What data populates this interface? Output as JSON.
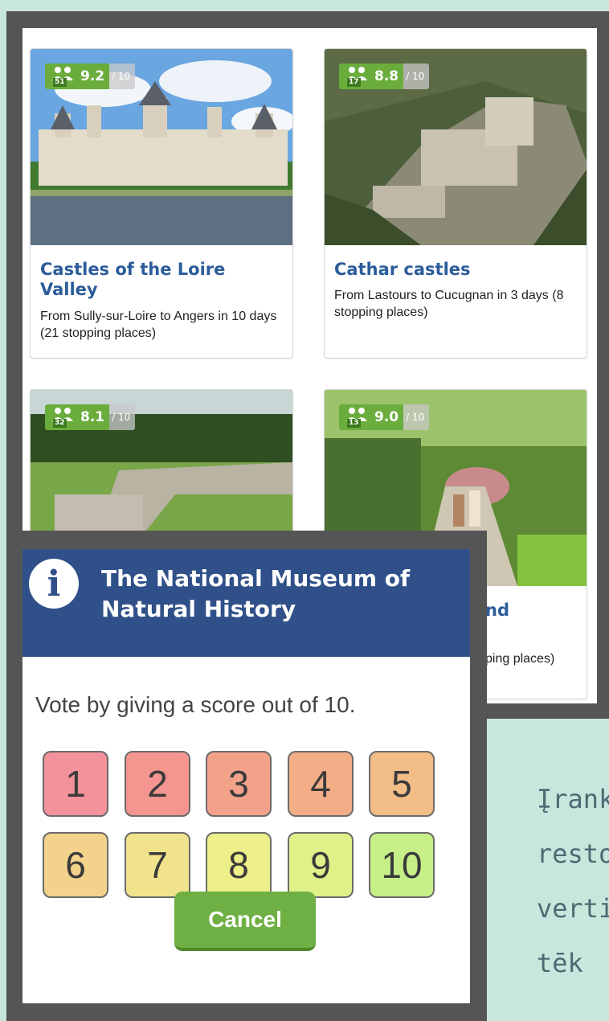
{
  "cards": [
    {
      "count": "51",
      "score": "9.2",
      "score_of": "/ 10",
      "title": "Castles of the Loire Valley",
      "description": "From Sully-sur-Loire to Angers in 10 days (21 stopping places)"
    },
    {
      "count": "17",
      "score": "8.8",
      "score_of": "/ 10",
      "title": "Cathar castles",
      "description": "From Lastours to Cucugnan in 3 days (8 stopping places)"
    },
    {
      "count": "32",
      "score": "8.1",
      "score_of": "/ 10",
      "title": "",
      "description": ""
    },
    {
      "count": "13",
      "score": "9.0",
      "score_of": "/ 10",
      "title": "nd",
      "description": "ping places)"
    }
  ],
  "modal": {
    "title": "The National Museum of Natural History",
    "prompt": "Vote by giving a score out of 10.",
    "scores": [
      {
        "label": "1",
        "color": "#f4929b"
      },
      {
        "label": "2",
        "color": "#f49590"
      },
      {
        "label": "3",
        "color": "#f3a28a"
      },
      {
        "label": "4",
        "color": "#f3ae88"
      },
      {
        "label": "5",
        "color": "#f3bd88"
      },
      {
        "label": "6",
        "color": "#f3d28c"
      },
      {
        "label": "7",
        "color": "#f1e38c"
      },
      {
        "label": "8",
        "color": "#edef88"
      },
      {
        "label": "9",
        "color": "#dff289"
      },
      {
        "label": "10",
        "color": "#c6ef88"
      }
    ],
    "cancel_label": "Cancel"
  },
  "side_text": [
    "Įrank",
    "resto",
    "vertir",
    "tēk"
  ]
}
